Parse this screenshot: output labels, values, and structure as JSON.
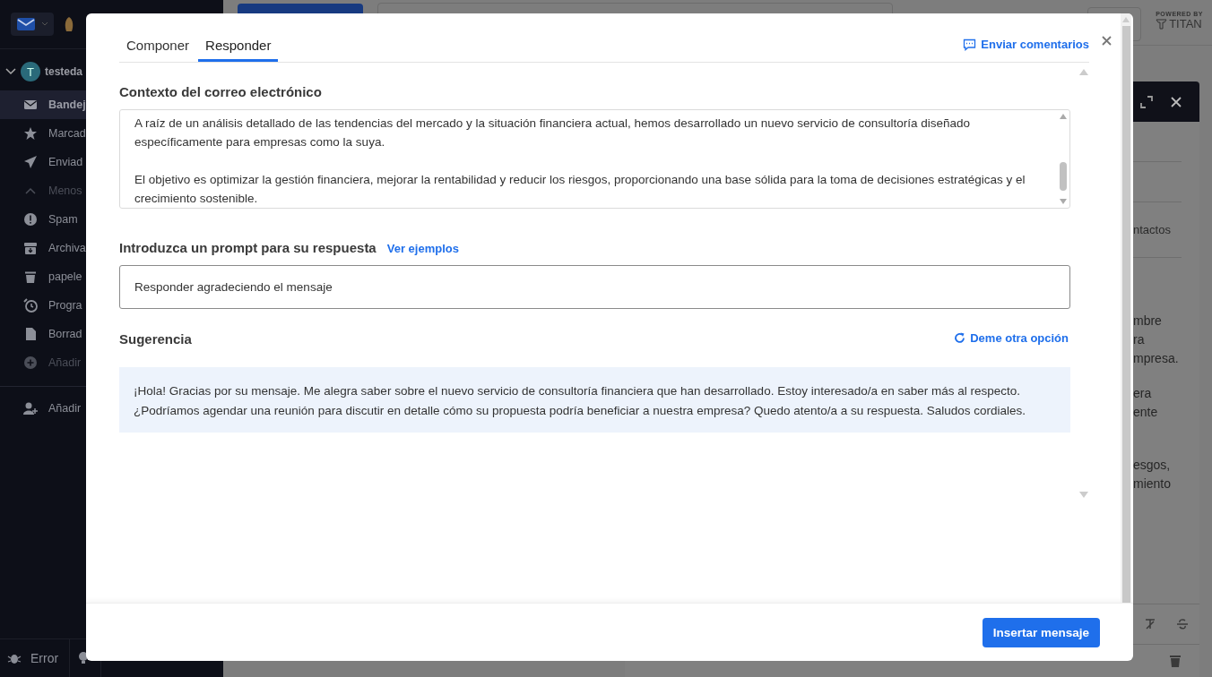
{
  "app": {
    "account": {
      "avatar": "T",
      "name": "testeda",
      "expanded": true
    },
    "sidebar_items": [
      {
        "label": "Bandej",
        "selected": true,
        "disabled": false
      },
      {
        "label": "Marcad",
        "selected": false,
        "disabled": false
      },
      {
        "label": "Enviad",
        "selected": false,
        "disabled": false
      },
      {
        "label": "Menos",
        "selected": false,
        "disabled": true
      },
      {
        "label": "Spam",
        "selected": false,
        "disabled": false
      },
      {
        "label": "Archiva",
        "selected": false,
        "disabled": false
      },
      {
        "label": "papele",
        "selected": false,
        "disabled": false
      },
      {
        "label": "Progra",
        "selected": false,
        "disabled": false
      },
      {
        "label": "Borrad",
        "selected": false,
        "disabled": false
      },
      {
        "label": "Añadir",
        "selected": false,
        "disabled": true
      }
    ],
    "add_account": "Añadir",
    "bottom_bar": [
      "Error"
    ],
    "brand": {
      "powered_by": "POWERED BY",
      "name": "TITAN"
    },
    "compose_contacts": "ntactos",
    "compose_paragraphs": [
      [
        "mbre",
        "ra",
        "mpresa."
      ],
      [
        "era",
        "ente"
      ],
      [
        "esgos,",
        "miento"
      ]
    ]
  },
  "dialog": {
    "tabs": [
      {
        "label": "Componer",
        "selected": false
      },
      {
        "label": "Responder",
        "selected": true
      }
    ],
    "feedback_link": "Enviar comentarios",
    "context": {
      "title": "Contexto del correo electrónico",
      "paragraphs": [
        "A raíz de un análisis detallado de las tendencias del mercado y la situación financiera actual, hemos desarrollado un nuevo servicio de consultoría diseñado específicamente para empresas como la suya.",
        "El objetivo es optimizar la gestión financiera, mejorar la rentabilidad y reducir los riesgos, proporcionando una base sólida para la toma de decisiones estratégicas y el crecimiento sostenible."
      ]
    },
    "prompt": {
      "title": "Introduzca un prompt para su respuesta",
      "examples_link": "Ver ejemplos",
      "value": "Responder agradeciendo el mensaje"
    },
    "suggestion": {
      "title": "Sugerencia",
      "retry_link": "Deme otra opción",
      "text": "¡Hola! Gracias por su mensaje. Me alegra saber sobre el nuevo servicio de consultoría financiera que han desarrollado. Estoy interesado/a en saber más al respecto. ¿Podríamos agendar una reunión para discutir en detalle cómo su propuesta podría beneficiar a nuestra empresa? Quedo atento/a a su respuesta. Saludos cordiales."
    },
    "insert_button": "Insertar mensaje"
  }
}
